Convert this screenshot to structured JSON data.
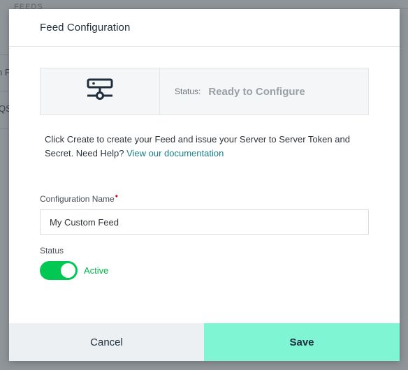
{
  "background": {
    "top_label": "FEEDS",
    "fragment_1": "n F",
    "fragment_2": "QS"
  },
  "modal": {
    "title": "Feed Configuration",
    "status_card": {
      "icon": "server-network-icon",
      "status_label": "Status:",
      "status_value": "Ready to Configure"
    },
    "intro": {
      "text": "Click Create to create your Feed and issue your Server to Server Token and Secret. Need Help?",
      "link_text": "View our documentation"
    },
    "form": {
      "name_label": "Configuration Name",
      "required_mark": "•",
      "name_value": "My Custom Feed",
      "status_label": "Status",
      "status_toggle_on": true,
      "status_toggle_text": "Active"
    },
    "footer": {
      "cancel_label": "Cancel",
      "save_label": "Save"
    }
  },
  "colors": {
    "accent_green": "#00c853",
    "save_button": "#7ff5d4",
    "link": "#1a7f88",
    "required": "#d0021b"
  }
}
